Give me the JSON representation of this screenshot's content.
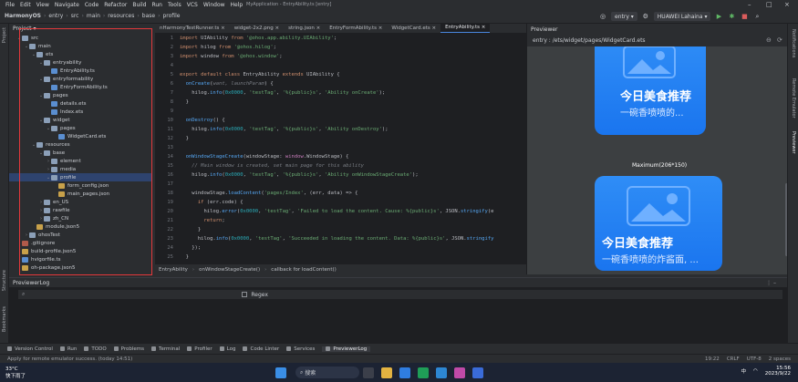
{
  "titlebar": {
    "menu": [
      "File",
      "Edit",
      "View",
      "Navigate",
      "Code",
      "Refactor",
      "Build",
      "Run",
      "Tools",
      "VCS",
      "Window",
      "Help"
    ],
    "title": "MyApplication - EntryAbility.ts [entry]"
  },
  "navbar": {
    "crumbs": [
      "HarmonyOS",
      "entry",
      "src",
      "main",
      "resources",
      "base",
      "profile"
    ],
    "module": "entry",
    "device": "HUAWEI Lahaina"
  },
  "project": {
    "header": "Project",
    "tree": [
      {
        "label": "src",
        "depth": 1,
        "type": "folder",
        "open": true
      },
      {
        "label": "main",
        "depth": 2,
        "type": "folder",
        "open": true
      },
      {
        "label": "ets",
        "depth": 3,
        "type": "folder",
        "open": true
      },
      {
        "label": "entryability",
        "depth": 4,
        "type": "folder",
        "open": true
      },
      {
        "label": "EntryAbility.ts",
        "depth": 5,
        "type": "ts"
      },
      {
        "label": "entryformability",
        "depth": 4,
        "type": "folder",
        "open": true
      },
      {
        "label": "EntryFormAbility.ts",
        "depth": 5,
        "type": "ts"
      },
      {
        "label": "pages",
        "depth": 4,
        "type": "folder",
        "open": true
      },
      {
        "label": "details.ets",
        "depth": 5,
        "type": "ts"
      },
      {
        "label": "Index.ets",
        "depth": 5,
        "type": "ts"
      },
      {
        "label": "widget",
        "depth": 4,
        "type": "folder",
        "open": true
      },
      {
        "label": "pages",
        "depth": 5,
        "type": "folder",
        "open": true
      },
      {
        "label": "WidgetCard.ets",
        "depth": 6,
        "type": "ts"
      },
      {
        "label": "resources",
        "depth": 3,
        "type": "folder",
        "open": true
      },
      {
        "label": "base",
        "depth": 4,
        "type": "folder",
        "open": true
      },
      {
        "label": "element",
        "depth": 5,
        "type": "folder"
      },
      {
        "label": "media",
        "depth": 5,
        "type": "folder"
      },
      {
        "label": "profile",
        "depth": 5,
        "type": "folder",
        "open": true,
        "selected": true
      },
      {
        "label": "form_config.json",
        "depth": 6,
        "type": "json"
      },
      {
        "label": "main_pages.json",
        "depth": 6,
        "type": "json"
      },
      {
        "label": "en_US",
        "depth": 4,
        "type": "folder"
      },
      {
        "label": "rawfile",
        "depth": 4,
        "type": "folder"
      },
      {
        "label": "zh_CN",
        "depth": 4,
        "type": "folder"
      },
      {
        "label": "module.json5",
        "depth": 3,
        "type": "json"
      },
      {
        "label": "ohosTest",
        "depth": 2,
        "type": "folder"
      },
      {
        "label": ".gitignore",
        "depth": 1,
        "type": "git"
      },
      {
        "label": "build-profile.json5",
        "depth": 1,
        "type": "json"
      },
      {
        "label": "hvigorfile.ts",
        "depth": 1,
        "type": "ts"
      },
      {
        "label": "oh-package.json5",
        "depth": 1,
        "type": "json"
      }
    ]
  },
  "tabs": [
    {
      "label": "nHarmonyTestRunner.ts",
      "active": false
    },
    {
      "label": "widget-2x2.png",
      "active": false
    },
    {
      "label": "string.json",
      "active": false
    },
    {
      "label": "EntryFormAbility.ts",
      "active": false
    },
    {
      "label": "WidgetCard.ets",
      "active": false
    },
    {
      "label": "EntryAbility.ts",
      "active": true
    }
  ],
  "editor": {
    "lines": [
      {
        "n": "1",
        "html": "<span class=\"kw\">import</span> UIAbility <span class=\"kw\">from</span> <span class=\"str\">'@ohos.app.ability.UIAbility'</span>;"
      },
      {
        "n": "2",
        "html": "<span class=\"kw\">import</span> hilog <span class=\"kw\">from</span> <span class=\"str\">'@ohos.hilog'</span>;"
      },
      {
        "n": "3",
        "html": "<span class=\"kw\">import</span> window <span class=\"kw\">from</span> <span class=\"str\">'@ohos.window'</span>;"
      },
      {
        "n": "4",
        "html": ""
      },
      {
        "n": "5",
        "html": "<span class=\"kw\">export default class</span> EntryAbility <span class=\"kw\">extends</span> UIAbility {"
      },
      {
        "n": "6",
        "html": "  <span class=\"fn\">onCreate</span>(<span class=\"cmt\">want, launchParam</span>) {"
      },
      {
        "n": "7",
        "html": "    hilog.<span class=\"fn\">info</span>(<span class=\"num\">0x0000</span>, <span class=\"str\">'testTag'</span>, <span class=\"str\">'%{public}s'</span>, <span class=\"str\">'Ability onCreate'</span>);"
      },
      {
        "n": "8",
        "html": "  }"
      },
      {
        "n": "9",
        "html": ""
      },
      {
        "n": "10",
        "html": "  <span class=\"fn\">onDestroy</span>() {"
      },
      {
        "n": "11",
        "html": "    hilog.<span class=\"fn\">info</span>(<span class=\"num\">0x0000</span>, <span class=\"str\">'testTag'</span>, <span class=\"str\">'%{public}s'</span>, <span class=\"str\">'Ability onDestroy'</span>);"
      },
      {
        "n": "12",
        "html": "  }"
      },
      {
        "n": "13",
        "html": ""
      },
      {
        "n": "14",
        "html": "  <span class=\"fn\">onWindowStageCreate</span>(windowStage: <span class=\"cls\">window</span>.WindowStage) {"
      },
      {
        "n": "15",
        "html": "    <span class=\"cmt\">// Main window is created, set main page for this ability</span>"
      },
      {
        "n": "16",
        "html": "    hilog.<span class=\"fn\">info</span>(<span class=\"num\">0x0000</span>, <span class=\"str\">'testTag'</span>, <span class=\"str\">'%{public}s'</span>, <span class=\"str\">'Ability onWindowStageCreate'</span>);"
      },
      {
        "n": "17",
        "html": ""
      },
      {
        "n": "18",
        "html": "    windowStage.<span class=\"fn\">loadContent</span>(<span class=\"str\">'pages/Index'</span>, (err, data) => {"
      },
      {
        "n": "19",
        "html": "      <span class=\"kw\">if</span> (err.code) {"
      },
      {
        "n": "20",
        "html": "        hilog.<span class=\"fn\">error</span>(<span class=\"num\">0x0000</span>, <span class=\"str\">'testTag'</span>, <span class=\"str\">'Failed to load the content. Cause: %{public}s'</span>, JSON.<span class=\"fn\">stringify</span>(e"
      },
      {
        "n": "21",
        "html": "        <span class=\"kw\">return</span>;"
      },
      {
        "n": "22",
        "html": "      }"
      },
      {
        "n": "23",
        "html": "      hilog.<span class=\"fn\">info</span>(<span class=\"num\">0x0000</span>, <span class=\"str\">'testTag'</span>, <span class=\"str\">'Succeeded in loading the content. Data: %{public}s'</span>, JSON.<span class=\"fn\">stringify</span>"
      },
      {
        "n": "24",
        "html": "    });"
      },
      {
        "n": "25",
        "html": "  }"
      }
    ],
    "footer": [
      "EntryAbility",
      "onWindowStageCreate()",
      "callback for loadContent()"
    ]
  },
  "previewer": {
    "label": "Previewer",
    "path": "entry : /ets/widget/pages/WidgetCard.ets",
    "card1": {
      "title": "今日美食推荐",
      "subtitle": "一碗香喷喷的..."
    },
    "maximum_label": "Maximum(206*150)",
    "card2": {
      "title": "今日美食推荐",
      "subtitle": "一碗香喷喷的炸酱面, ..."
    }
  },
  "log": {
    "header": "PreviewerLog",
    "regex_label": "Regex"
  },
  "tools": [
    "Version Control",
    "Run",
    "TODO",
    "Problems",
    "Terminal",
    "Profiler",
    "Log",
    "Code Linter",
    "Services",
    "PreviewerLog"
  ],
  "status": {
    "message": "Apply for remote emulator success. (today 14:51)",
    "position": "19:22",
    "line_sep": "CRLF",
    "encoding": "UTF-8",
    "indent": "2 spaces"
  },
  "taskbar": {
    "weather_temp": "33°C",
    "weather_desc": "快下雨了",
    "search": "搜索",
    "time": "15:56",
    "date": "2023/9/22",
    "lang": "中"
  },
  "strips": {
    "project": "Project",
    "structure": "Structure",
    "bookmarks": "Bookmarks",
    "notifications": "Notifications",
    "remote_emulator": "Remote Emulator",
    "previewer": "Previewer"
  }
}
